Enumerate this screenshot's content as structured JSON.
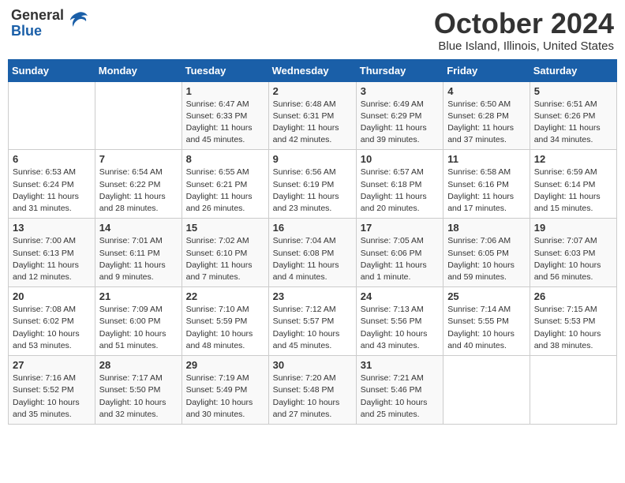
{
  "logo": {
    "general": "General",
    "blue": "Blue"
  },
  "title": "October 2024",
  "location": "Blue Island, Illinois, United States",
  "days_of_week": [
    "Sunday",
    "Monday",
    "Tuesday",
    "Wednesday",
    "Thursday",
    "Friday",
    "Saturday"
  ],
  "weeks": [
    [
      {
        "day": null
      },
      {
        "day": null
      },
      {
        "day": 1,
        "sunrise": "6:47 AM",
        "sunset": "6:33 PM",
        "daylight": "11 hours and 45 minutes."
      },
      {
        "day": 2,
        "sunrise": "6:48 AM",
        "sunset": "6:31 PM",
        "daylight": "11 hours and 42 minutes."
      },
      {
        "day": 3,
        "sunrise": "6:49 AM",
        "sunset": "6:29 PM",
        "daylight": "11 hours and 39 minutes."
      },
      {
        "day": 4,
        "sunrise": "6:50 AM",
        "sunset": "6:28 PM",
        "daylight": "11 hours and 37 minutes."
      },
      {
        "day": 5,
        "sunrise": "6:51 AM",
        "sunset": "6:26 PM",
        "daylight": "11 hours and 34 minutes."
      }
    ],
    [
      {
        "day": 6,
        "sunrise": "6:53 AM",
        "sunset": "6:24 PM",
        "daylight": "11 hours and 31 minutes."
      },
      {
        "day": 7,
        "sunrise": "6:54 AM",
        "sunset": "6:22 PM",
        "daylight": "11 hours and 28 minutes."
      },
      {
        "day": 8,
        "sunrise": "6:55 AM",
        "sunset": "6:21 PM",
        "daylight": "11 hours and 26 minutes."
      },
      {
        "day": 9,
        "sunrise": "6:56 AM",
        "sunset": "6:19 PM",
        "daylight": "11 hours and 23 minutes."
      },
      {
        "day": 10,
        "sunrise": "6:57 AM",
        "sunset": "6:18 PM",
        "daylight": "11 hours and 20 minutes."
      },
      {
        "day": 11,
        "sunrise": "6:58 AM",
        "sunset": "6:16 PM",
        "daylight": "11 hours and 17 minutes."
      },
      {
        "day": 12,
        "sunrise": "6:59 AM",
        "sunset": "6:14 PM",
        "daylight": "11 hours and 15 minutes."
      }
    ],
    [
      {
        "day": 13,
        "sunrise": "7:00 AM",
        "sunset": "6:13 PM",
        "daylight": "11 hours and 12 minutes."
      },
      {
        "day": 14,
        "sunrise": "7:01 AM",
        "sunset": "6:11 PM",
        "daylight": "11 hours and 9 minutes."
      },
      {
        "day": 15,
        "sunrise": "7:02 AM",
        "sunset": "6:10 PM",
        "daylight": "11 hours and 7 minutes."
      },
      {
        "day": 16,
        "sunrise": "7:04 AM",
        "sunset": "6:08 PM",
        "daylight": "11 hours and 4 minutes."
      },
      {
        "day": 17,
        "sunrise": "7:05 AM",
        "sunset": "6:06 PM",
        "daylight": "11 hours and 1 minute."
      },
      {
        "day": 18,
        "sunrise": "7:06 AM",
        "sunset": "6:05 PM",
        "daylight": "10 hours and 59 minutes."
      },
      {
        "day": 19,
        "sunrise": "7:07 AM",
        "sunset": "6:03 PM",
        "daylight": "10 hours and 56 minutes."
      }
    ],
    [
      {
        "day": 20,
        "sunrise": "7:08 AM",
        "sunset": "6:02 PM",
        "daylight": "10 hours and 53 minutes."
      },
      {
        "day": 21,
        "sunrise": "7:09 AM",
        "sunset": "6:00 PM",
        "daylight": "10 hours and 51 minutes."
      },
      {
        "day": 22,
        "sunrise": "7:10 AM",
        "sunset": "5:59 PM",
        "daylight": "10 hours and 48 minutes."
      },
      {
        "day": 23,
        "sunrise": "7:12 AM",
        "sunset": "5:57 PM",
        "daylight": "10 hours and 45 minutes."
      },
      {
        "day": 24,
        "sunrise": "7:13 AM",
        "sunset": "5:56 PM",
        "daylight": "10 hours and 43 minutes."
      },
      {
        "day": 25,
        "sunrise": "7:14 AM",
        "sunset": "5:55 PM",
        "daylight": "10 hours and 40 minutes."
      },
      {
        "day": 26,
        "sunrise": "7:15 AM",
        "sunset": "5:53 PM",
        "daylight": "10 hours and 38 minutes."
      }
    ],
    [
      {
        "day": 27,
        "sunrise": "7:16 AM",
        "sunset": "5:52 PM",
        "daylight": "10 hours and 35 minutes."
      },
      {
        "day": 28,
        "sunrise": "7:17 AM",
        "sunset": "5:50 PM",
        "daylight": "10 hours and 32 minutes."
      },
      {
        "day": 29,
        "sunrise": "7:19 AM",
        "sunset": "5:49 PM",
        "daylight": "10 hours and 30 minutes."
      },
      {
        "day": 30,
        "sunrise": "7:20 AM",
        "sunset": "5:48 PM",
        "daylight": "10 hours and 27 minutes."
      },
      {
        "day": 31,
        "sunrise": "7:21 AM",
        "sunset": "5:46 PM",
        "daylight": "10 hours and 25 minutes."
      },
      {
        "day": null
      },
      {
        "day": null
      }
    ]
  ]
}
